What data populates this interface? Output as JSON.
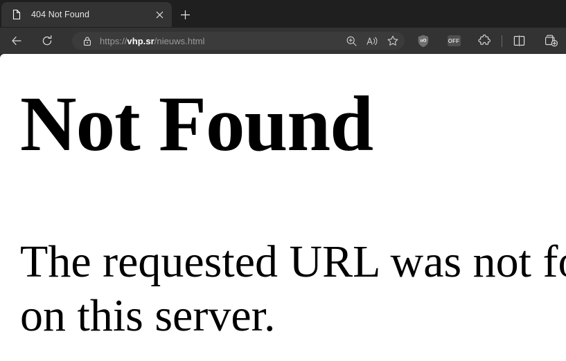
{
  "browser": {
    "tabs": [
      {
        "title": "404 Not Found",
        "favicon": "page-icon",
        "close_label": "×",
        "active": true
      }
    ],
    "new_tab_label": "+",
    "toolbar": {
      "back_label": "Back",
      "reload_label": "Refresh",
      "site_info_label": "View site information",
      "url": {
        "scheme": "https://",
        "host": "vhp.sr",
        "path": "/nieuws.html",
        "full": "https://vhp.sr/nieuws.html"
      },
      "address_actions": [
        {
          "name": "zoom-icon",
          "label": "Zoom in"
        },
        {
          "name": "read-aloud-icon",
          "label": "Read this page aloud"
        },
        {
          "name": "favorite-star-icon",
          "label": "Add this page to favorites"
        }
      ],
      "extensions": [
        {
          "name": "ublock-origin-icon",
          "label": "uBlock Origin",
          "badge": "uO"
        },
        {
          "name": "extension-off-badge",
          "label": "OFF",
          "badge": "OFF"
        },
        {
          "name": "puzzle-piece-icon",
          "label": "Extensions"
        }
      ],
      "split_screen_label": "Split screen",
      "collections_label": "Collections"
    },
    "colors": {
      "tab_strip_bg": "#1f1f1f",
      "toolbar_bg": "#333333",
      "active_tab_bg": "#333333",
      "address_bar_bg": "#3b3b3b",
      "url_host_color": "#ffffff",
      "url_dim_color": "#9b9b9b",
      "page_bg": "#ffffff",
      "page_text": "#000000"
    }
  },
  "page": {
    "heading": "Not Found",
    "body_line1": "The requested URL was not found",
    "body_line2": "on this server."
  }
}
